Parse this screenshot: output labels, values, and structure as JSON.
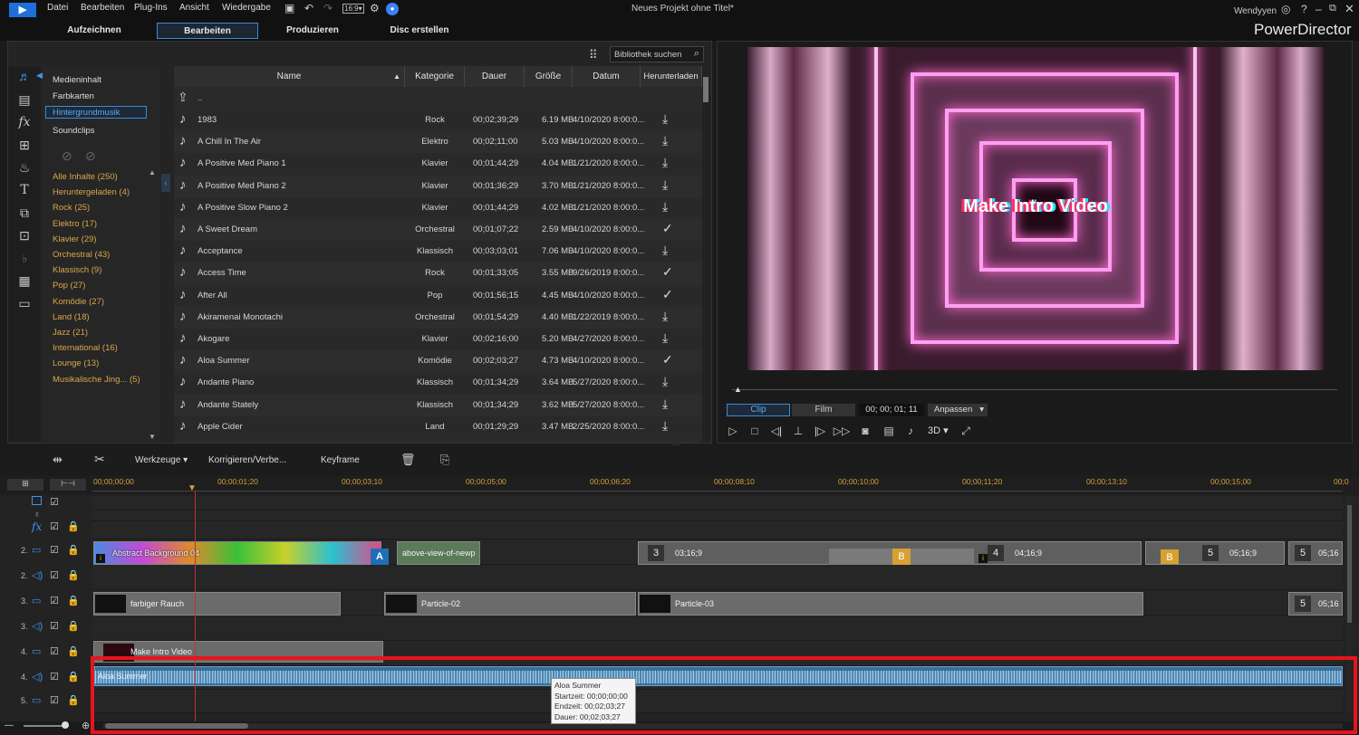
{
  "menu": [
    "Datei",
    "Bearbeiten",
    "Plug-Ins",
    "Ansicht",
    "Wiedergabe"
  ],
  "window_title": "Neues Projekt ohne Titel*",
  "user": "Wendyyen",
  "brand": "PowerDirector",
  "modes": [
    "Aufzeichnen",
    "Bearbeiten",
    "Produzieren",
    "Disc erstellen"
  ],
  "active_mode": "Bearbeiten",
  "search_placeholder": "Bibliothek suchen",
  "content_types": [
    "Medieninhalt",
    "Farbkarten",
    "Hintergrundmusik",
    "Soundclips"
  ],
  "active_content_type": "Hintergrundmusik",
  "categories": [
    "Alle Inhalte  (250)",
    "Heruntergeladen  (4)",
    "Rock  (25)",
    "Elektro  (17)",
    "Klavier  (29)",
    "Orchestral  (43)",
    "Klassisch  (9)",
    "Pop  (27)",
    "Komödie  (27)",
    "Land  (18)",
    "Jazz  (21)",
    "International  (16)",
    "Lounge  (13)",
    "Musikalische Jing...  (5)"
  ],
  "table": {
    "headers": [
      "Name",
      "Kategorie",
      "Dauer",
      "Größe",
      "Datum",
      "Herunterladen"
    ],
    "parent_row": "..",
    "rows": [
      {
        "name": "1983",
        "cat": "Rock",
        "dur": "00;02;39;29",
        "size": "6.19 MB",
        "date": "4/10/2020 8:00:0...",
        "dl": "download"
      },
      {
        "name": "A Chill In The Air",
        "cat": "Elektro",
        "dur": "00;02;11;00",
        "size": "5.03 MB",
        "date": "4/10/2020 8:00:0...",
        "dl": "download"
      },
      {
        "name": "A Positive Med Piano 1",
        "cat": "Klavier",
        "dur": "00;01;44;29",
        "size": "4.04 MB",
        "date": "1/21/2020 8:00:0...",
        "dl": "download"
      },
      {
        "name": "A Positive Med Piano 2",
        "cat": "Klavier",
        "dur": "00;01;36;29",
        "size": "3.70 MB",
        "date": "1/21/2020 8:00:0...",
        "dl": "download"
      },
      {
        "name": "A Positive Slow Piano 2",
        "cat": "Klavier",
        "dur": "00;01;44;29",
        "size": "4.02 MB",
        "date": "1/21/2020 8:00:0...",
        "dl": "download"
      },
      {
        "name": "A Sweet Dream",
        "cat": "Orchestral",
        "dur": "00;01;07;22",
        "size": "2.59 MB",
        "date": "4/10/2020 8:00:0...",
        "dl": "check"
      },
      {
        "name": "Acceptance",
        "cat": "Klassisch",
        "dur": "00;03;03;01",
        "size": "7.06 MB",
        "date": "4/10/2020 8:00:0...",
        "dl": "download"
      },
      {
        "name": "Access Time",
        "cat": "Rock",
        "dur": "00;01;33;05",
        "size": "3.55 MB",
        "date": "9/26/2019 8:00:0...",
        "dl": "check"
      },
      {
        "name": "After All",
        "cat": "Pop",
        "dur": "00;01;56;15",
        "size": "4.45 MB",
        "date": "4/10/2020 8:00:0...",
        "dl": "check"
      },
      {
        "name": "Akiramenai Monotachi",
        "cat": "Orchestral",
        "dur": "00;01;54;29",
        "size": "4.40 MB",
        "date": "1/22/2019 8:00:0...",
        "dl": "download"
      },
      {
        "name": "Akogare",
        "cat": "Klavier",
        "dur": "00;02;16;00",
        "size": "5.20 MB",
        "date": "4/27/2020 8:00:0...",
        "dl": "download"
      },
      {
        "name": "Aloa Summer",
        "cat": "Komödie",
        "dur": "00;02;03;27",
        "size": "4.73 MB",
        "date": "4/10/2020 8:00:0...",
        "dl": "check"
      },
      {
        "name": "Andante Piano",
        "cat": "Klassisch",
        "dur": "00;01;34;29",
        "size": "3.64 MB",
        "date": "5/27/2020 8:00:0...",
        "dl": "download"
      },
      {
        "name": "Andante Stately",
        "cat": "Klassisch",
        "dur": "00;01;34;29",
        "size": "3.62 MB",
        "date": "5/27/2020 8:00:0...",
        "dl": "download"
      },
      {
        "name": "Apple Cider",
        "cat": "Land",
        "dur": "00;01;29;29",
        "size": "3.47 MB",
        "date": "2/25/2020 8:00:0...",
        "dl": "download"
      }
    ]
  },
  "preview": {
    "video_title": "Make Intro Video",
    "tab_clip": "Clip",
    "tab_film": "Film",
    "timecode": "00; 00; 01; 11",
    "fit": "Anpassen",
    "mode_3d": "3D"
  },
  "toolbar": {
    "tools": "Werkzeuge",
    "correct": "Korrigieren/Verbe...",
    "keyframe": "Keyframe"
  },
  "ruler": [
    "00;00;00;00",
    "00;00;01;20",
    "00;00;03;10",
    "00;00;05;00",
    "00;00;06;20",
    "00;00;08;10",
    "00;00;10;00",
    "00;00;11;20",
    "00;00;13;10",
    "00;00;15;00",
    "00;0"
  ],
  "track_labels": [
    "2.",
    "2.",
    "3.",
    "3.",
    "4.",
    "4.",
    "5."
  ],
  "clips": {
    "abstract": "Abstract Background 04",
    "above": "above-view-of-newp",
    "c3": "3",
    "c3_time": "03;16;9",
    "c4": "4",
    "c4_time": "04;16;9",
    "c5": "5",
    "c5_time": "05;16;9",
    "c5b": "5",
    "c5b_time": "05;16",
    "rauch": "farbiger Rauch",
    "p02": "Particle-02",
    "p03": "Particle-03",
    "intro": "Make Intro Video",
    "audio": "Aloa Summer"
  },
  "tooltip": {
    "name": "Aloa Summer",
    "start": "Startzeit: 00;00;00;00",
    "end": "Endzeit: 00;02;03;27",
    "dur": "Dauer: 00;02;03;27"
  }
}
